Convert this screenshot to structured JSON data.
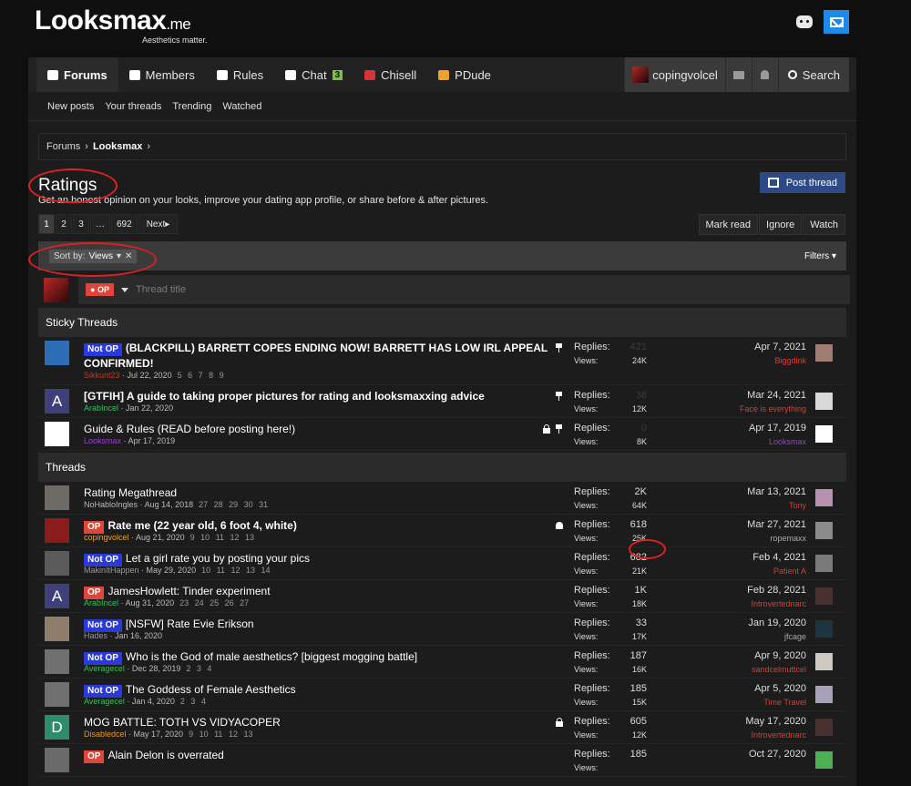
{
  "site": {
    "name": "Looksmax",
    "tld": ".me",
    "tagline": "Aesthetics matter."
  },
  "nav": {
    "tabs": [
      {
        "label": "Forums",
        "icon": "forums-icon",
        "active": true
      },
      {
        "label": "Members",
        "icon": "members-icon"
      },
      {
        "label": "Rules",
        "icon": "rules-icon"
      },
      {
        "label": "Chat",
        "icon": "chat-icon",
        "badge": "3"
      },
      {
        "label": "Chisell",
        "icon": "chisell-icon"
      },
      {
        "label": "PDude",
        "icon": "pdude-icon"
      }
    ],
    "username": "copingvolcel",
    "search_label": "Search",
    "subnav": [
      "New posts",
      "Your threads",
      "Trending",
      "Watched"
    ]
  },
  "breadcrumb": [
    "Forums",
    "Looksmax"
  ],
  "page": {
    "title": "Ratings",
    "description": "Get an honest opinion on your looks, improve your dating app profile, or share before & after pictures.",
    "post_thread": "Post thread",
    "pages": [
      "1",
      "2",
      "3",
      "…",
      "692"
    ],
    "next": "Next",
    "actions": [
      "Mark read",
      "Ignore",
      "Watch"
    ],
    "sort_label": "Sort by:",
    "sort_value": "Views",
    "filters": "Filters",
    "op_prefix": "OP",
    "thread_title_placeholder": "Thread title"
  },
  "labels": {
    "notop": "Not OP",
    "op": "OP",
    "replies": "Replies:",
    "views": "Views:"
  },
  "sticky_heading": "Sticky Threads",
  "threads_heading": "Threads",
  "sticky": [
    {
      "prefix": "notop",
      "title": "(BLACKPILL) BARRETT COPES ENDING NOW! BARRETT HAS LOW IRL APPEAL CONFIRMED!",
      "bold": true,
      "author": "Sikkunt23",
      "author_color": "#c0392b",
      "date": "Jul 22, 2020",
      "pages": "5 6 7 8 9",
      "replies": "421",
      "views": "24K",
      "last_date": "Apr 7, 2021",
      "last_user": "Biggdink",
      "last_color": "#e03b2e",
      "pin": true,
      "lock": false,
      "avatar_color": "#2d6db5",
      "last_av": "#a07c72"
    },
    {
      "prefix": "",
      "title": "[GTFIH] A guide to taking proper pictures for rating and looksmaxxing advice",
      "bold": true,
      "author": "ArabIncel",
      "author_color": "#3bbf5a",
      "date": "Jan 22, 2020",
      "pages": "",
      "replies": "38",
      "views": "12K",
      "last_date": "Mar 24, 2021",
      "last_user": "Face is everything",
      "last_color": "#e03b2e",
      "pin": true,
      "lock": false,
      "avatar_letter": "A",
      "avatar_color": "#3f3f7a",
      "last_av": "#d8d8d8"
    },
    {
      "prefix": "",
      "title": "Guide & Rules (READ before posting here!)",
      "bold": false,
      "author": "Looksmax",
      "author_color": "#9b3fd1",
      "date": "Apr 17, 2019",
      "pages": "",
      "replies": "0",
      "views": "8K",
      "last_date": "Apr 17, 2019",
      "last_user": "Looksmax",
      "last_color": "#9b3fd1",
      "pin": true,
      "lock": true,
      "avatar_color": "#ffffff",
      "last_av": "#ffffff"
    }
  ],
  "threads": [
    {
      "prefix": "",
      "title": "Rating Megathread",
      "bold": false,
      "author": "NoHabloIngles",
      "author_color": "#bbbbbb",
      "date": "Aug 14, 2018",
      "pages": "27 28 29 30 31",
      "replies": "2K",
      "views": "64K",
      "last_date": "Mar 13, 2021",
      "last_user": "Tony",
      "last_color": "#e03b2e",
      "avatar_color": "#6e6a66",
      "last_av": "#b890b0"
    },
    {
      "prefix": "op",
      "title": "Rate me (22 year old, 6 foot 4, white)",
      "bold": true,
      "author": "copingvolcel",
      "author_color": "#e8a23a",
      "date": "Aug 21, 2020",
      "pages": "9 10 11 12 13",
      "replies": "618",
      "views": "25K",
      "last_date": "Mar 27, 2021",
      "last_user": "ropemaxx",
      "last_color": "#aaaaaa",
      "bell": true,
      "avatar_color": "#8a1c1c",
      "last_av": "#8a8a8a"
    },
    {
      "prefix": "notop",
      "title": "Let a girl rate you by posting your pics",
      "bold": false,
      "author": "MakinItHappen",
      "author_color": "#999999",
      "date": "May 29, 2020",
      "pages": "10 11 12 13 14",
      "replies": "682",
      "views": "21K",
      "last_date": "Feb 4, 2021",
      "last_user": "Patient A",
      "last_color": "#e03b2e",
      "avatar_color": "#5a5a5a",
      "last_av": "#7a7a7a"
    },
    {
      "prefix": "op",
      "title": "JamesHowlett: Tinder experiment",
      "bold": false,
      "author": "ArabIncel",
      "author_color": "#3bbf5a",
      "date": "Aug 31, 2020",
      "pages": "23 24 25 26 27",
      "replies": "1K",
      "views": "18K",
      "last_date": "Feb 28, 2021",
      "last_user": "Introvertednarc",
      "last_color": "#e03b2e",
      "avatar_letter": "A",
      "avatar_color": "#3f3f7a",
      "last_av": "#4a3030"
    },
    {
      "prefix": "notop",
      "title": "[NSFW] Rate Evie Erikson",
      "bold": false,
      "author": "Hades",
      "author_color": "#999999",
      "date": "Jan 16, 2020",
      "pages": "",
      "replies": "33",
      "views": "17K",
      "last_date": "Jan 19, 2020",
      "last_user": "jfcage",
      "last_color": "#aaaaaa",
      "avatar_color": "#8f7d6c",
      "last_av": "#1c3540"
    },
    {
      "prefix": "notop",
      "title": "Who is the God of male aesthetics? [biggest mogging battle]",
      "bold": false,
      "author": "Averagecel",
      "author_color": "#3bbf5a",
      "date": "Dec 28, 2019",
      "pages": "2 3 4",
      "replies": "187",
      "views": "16K",
      "last_date": "Apr 9, 2020",
      "last_user": "sandcelmuttcel",
      "last_color": "#e03b2e",
      "avatar_color": "#707070",
      "last_av": "#cfc8c0"
    },
    {
      "prefix": "notop",
      "title": "The Goddess of Female Aesthetics",
      "bold": false,
      "author": "Averagecel",
      "author_color": "#3bbf5a",
      "date": "Jan 4, 2020",
      "pages": "2 3 4",
      "replies": "185",
      "views": "15K",
      "last_date": "Apr 5, 2020",
      "last_user": "Time Travel",
      "last_color": "#e03b2e",
      "avatar_color": "#707070",
      "last_av": "#a8a0b8"
    },
    {
      "prefix": "",
      "title": "MOG BATTLE: TOTH VS VIDYACOPER",
      "bold": false,
      "author": "Disabledcel",
      "author_color": "#e0962a",
      "date": "May 17, 2020",
      "pages": "9 10 11 12 13",
      "replies": "605",
      "views": "12K",
      "last_date": "May 17, 2020",
      "last_user": "Introvertednarc",
      "last_color": "#e03b2e",
      "lock": true,
      "avatar_letter": "D",
      "avatar_color": "#2f8c6a",
      "last_av": "#4a3030"
    },
    {
      "prefix": "op",
      "title": "Alain Delon is overrated",
      "bold": false,
      "author": "",
      "author_color": "#bbbbbb",
      "date": "",
      "pages": "",
      "replies": "185",
      "views": "",
      "last_date": "Oct 27, 2020",
      "last_user": "",
      "last_color": "#aaaaaa",
      "avatar_color": "#6a6a6a",
      "last_av": "#4caf50"
    }
  ]
}
